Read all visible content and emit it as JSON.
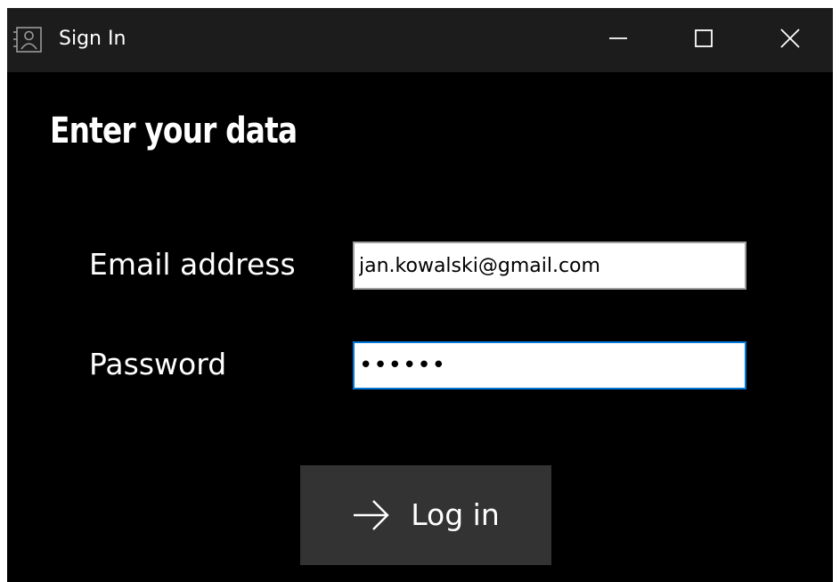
{
  "window": {
    "title": "Sign In",
    "icons": {
      "app": "contact-card-icon",
      "minimize": "minimize-icon",
      "maximize": "maximize-icon",
      "close": "close-icon"
    }
  },
  "form": {
    "heading": "Enter your data",
    "email_label": "Email address",
    "email_value": "jan.kowalski@gmail.com",
    "password_label": "Password",
    "password_value": "••••••",
    "login_label": "Log in",
    "login_icon": "arrow-right-icon"
  },
  "colors": {
    "background": "#000000",
    "titlebar": "#1c1c1c",
    "button": "#333333",
    "focus_border": "#0078d7"
  }
}
